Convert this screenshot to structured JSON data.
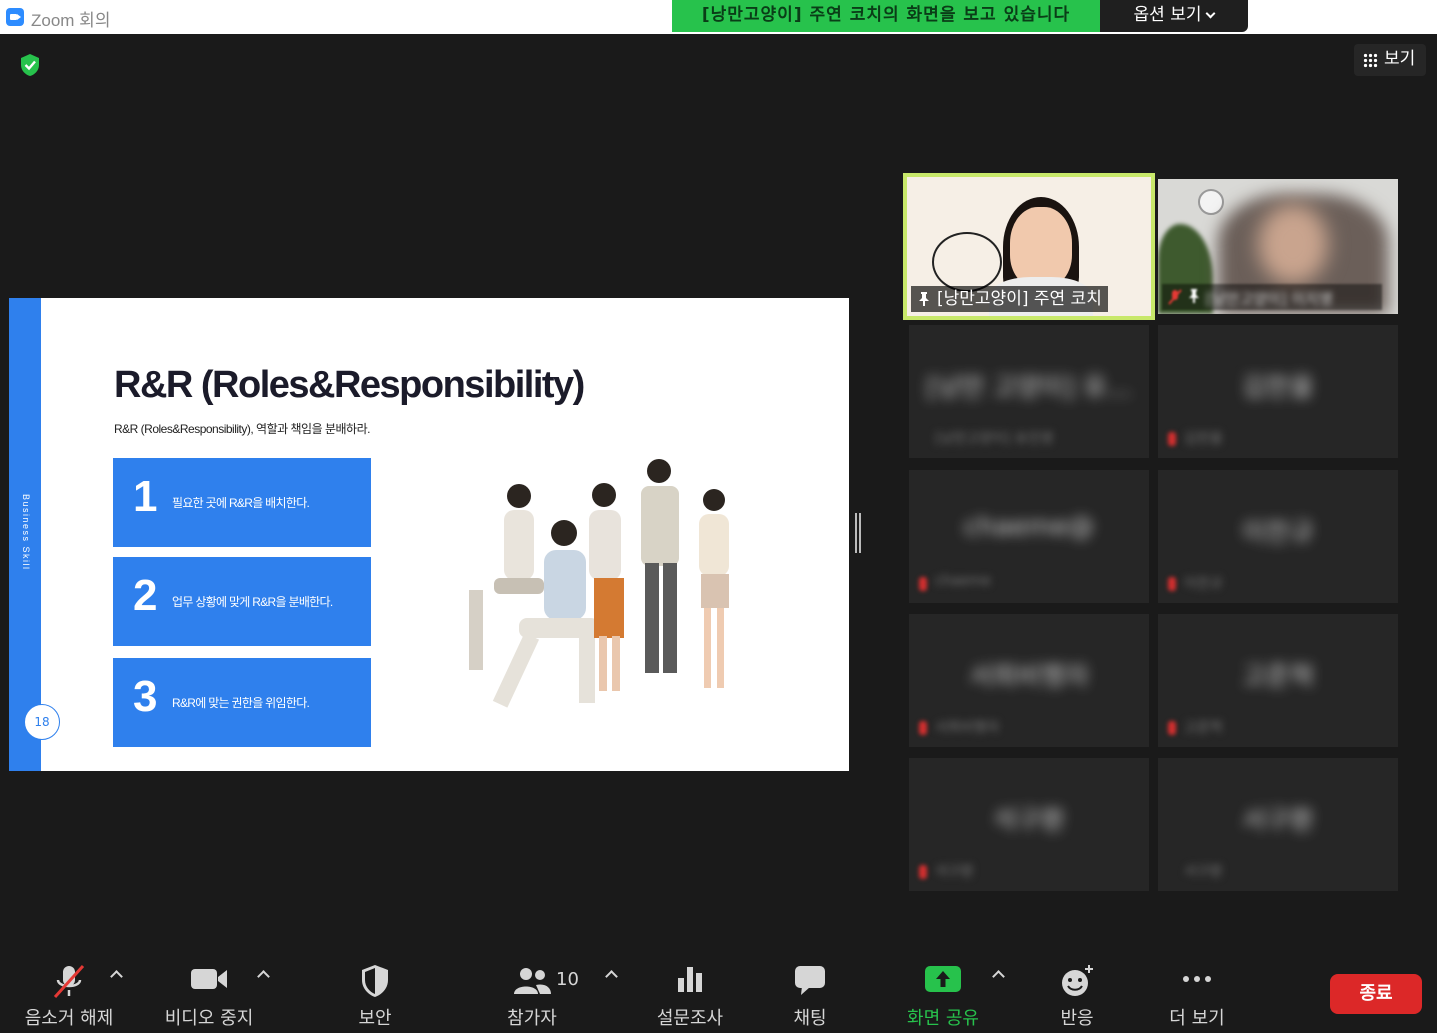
{
  "window": {
    "title": "Zoom 회의"
  },
  "share_banner": {
    "text": "[낭만고양이] 주연 코치의 화면을 보고 있습니다",
    "options_label": "옵션 보기"
  },
  "gallery_button": {
    "label": "보기"
  },
  "slide": {
    "vertical_label": "Business Skill",
    "page_number": "18",
    "heading": "R&R (Roles&Responsibility)",
    "subheading": "R&R (Roles&Responsibility), 역할과 책임을 분배하라.",
    "cards": [
      {
        "num": "1",
        "text": "필요한 곳에 R&R을 배치한다."
      },
      {
        "num": "2",
        "text": "업무 상황에 맞게 R&R을 분배한다."
      },
      {
        "num": "3",
        "text": "R&R에 맞는 권한을 위임한다."
      }
    ]
  },
  "participants": {
    "active_speaker": "[낭만고양이] 주연 코치",
    "second": "[낭만고양이] 이지영",
    "blurred": [
      {
        "name": "[낭만 고양이] 유...",
        "sub": "[낭만고양이] 유진영"
      },
      {
        "name": "김한울",
        "sub": "김한울"
      },
      {
        "name": "chaeme@",
        "sub": "chaeme"
      },
      {
        "name": "이찬규",
        "sub": "이찬규"
      },
      {
        "name": "서희비행자",
        "sub": "서희비행자"
      },
      {
        "name": "고준혁",
        "sub": "고준혁"
      },
      {
        "name": "석구환",
        "sub": "석구환"
      },
      {
        "name": "서구환",
        "sub": "서구환"
      }
    ]
  },
  "toolbar": {
    "unmute": "음소거 해제",
    "stop_video": "비디오 중지",
    "security": "보안",
    "participants": "참가자",
    "participant_count": "10",
    "polls": "설문조사",
    "chat": "채팅",
    "share_screen": "화면 공유",
    "reactions": "반응",
    "more": "더 보기",
    "end": "종료"
  },
  "colors": {
    "accent_green": "#27c24c",
    "slide_blue": "#2f80ed",
    "end_red": "#dc2828",
    "active_border": "#c8e86a"
  }
}
